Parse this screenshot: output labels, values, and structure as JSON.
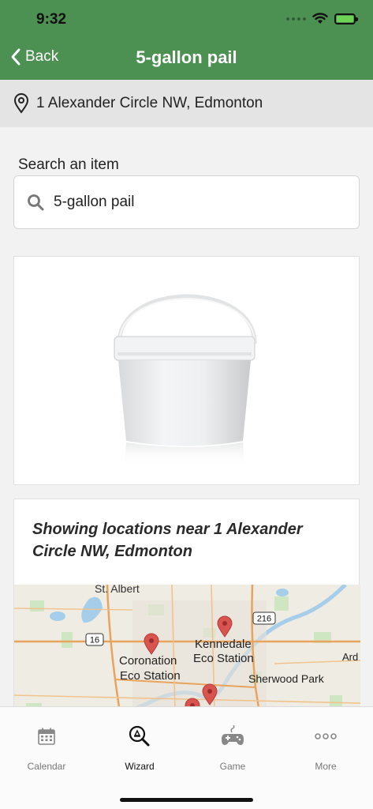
{
  "status_bar": {
    "time": "9:32"
  },
  "nav": {
    "back_label": "Back",
    "title": "5-gallon pail"
  },
  "address": {
    "text": "1 Alexander Circle NW, Edmonton"
  },
  "search": {
    "label": "Search an item",
    "value": "5-gallon pail"
  },
  "item_image": {
    "icon": "white-pail-image"
  },
  "locations": {
    "heading": "Showing locations near 1 Alexander Circle NW, Edmonton",
    "map_labels": {
      "st_albert": "St. Albert",
      "highway_216": "216",
      "highway_16": "16",
      "kennedale_line1": "Kennedale",
      "kennedale_line2": "Eco Station",
      "coronation_line1": "Coronation",
      "coronation_line2": "Eco Station",
      "sherwood_park": "Sherwood Park",
      "ard": "Ard"
    }
  },
  "tabs": [
    {
      "label": "Calendar",
      "icon": "calendar-icon",
      "active": false
    },
    {
      "label": "Wizard",
      "icon": "recycle-search-icon",
      "active": true
    },
    {
      "label": "Game",
      "icon": "gamepad-icon",
      "active": false
    },
    {
      "label": "More",
      "icon": "more-dots-icon",
      "active": false
    }
  ],
  "colors": {
    "header_green": "#4c9152",
    "map_pin_red": "#d9534f",
    "battery_green": "#6cd452"
  }
}
